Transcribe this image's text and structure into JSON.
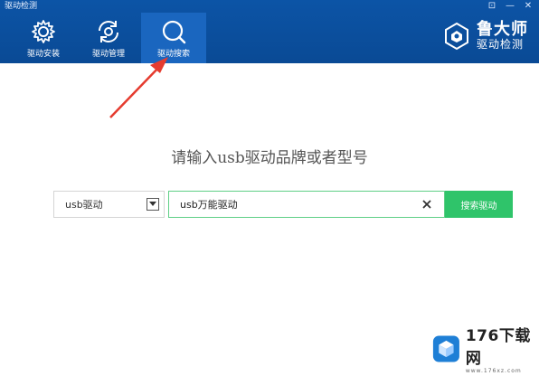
{
  "window": {
    "title": "驱动检测",
    "controls": [
      "⊡",
      "—",
      "✕"
    ]
  },
  "nav": [
    {
      "label": "驱动安装",
      "icon": "gear-icon"
    },
    {
      "label": "驱动管理",
      "icon": "refresh-gear-icon"
    },
    {
      "label": "驱动搜索",
      "icon": "search-icon",
      "active": true
    }
  ],
  "brand": {
    "name": "鲁大师",
    "sub": "驱动检测"
  },
  "search": {
    "prompt": "请输入usb驱动品牌或者型号",
    "category": "usb驱动",
    "query": "usb万能驱动",
    "button": "搜索驱动"
  },
  "watermark": {
    "name": "176下载网",
    "url": "www.176xz.com"
  },
  "colors": {
    "header": "#0c54a6",
    "accent": "#2fc46a",
    "arrow": "#e53b2f"
  }
}
